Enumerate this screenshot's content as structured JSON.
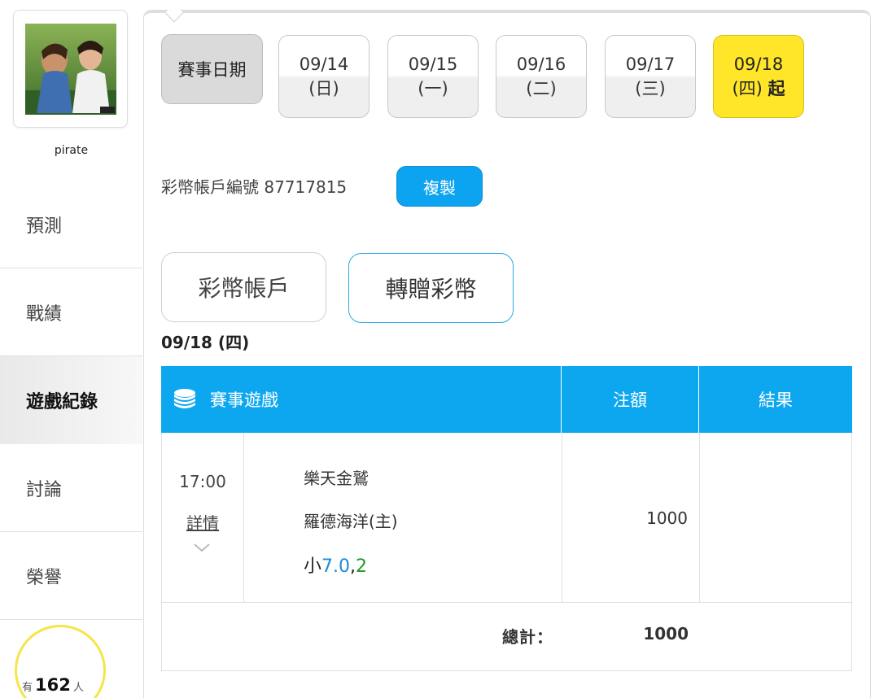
{
  "profile": {
    "username": "pirate"
  },
  "nav": {
    "predict": "預測",
    "record": "戰績",
    "history": "遊戲紀錄",
    "discuss": "討論",
    "honor": "榮譽"
  },
  "online": {
    "prefix": "有",
    "count": "162",
    "suffix": "人"
  },
  "dates": {
    "label": "賽事日期",
    "items": [
      {
        "date": "09/14",
        "weekday": "(日)"
      },
      {
        "date": "09/15",
        "weekday": "(一)"
      },
      {
        "date": "09/16",
        "weekday": "(二)"
      },
      {
        "date": "09/17",
        "weekday": "(三)"
      },
      {
        "date": "09/18",
        "weekday": "(四)",
        "suffix": "起"
      }
    ]
  },
  "account": {
    "label": "彩幣帳戶編號",
    "number": "87717815",
    "copy_label": "複製"
  },
  "tabs": {
    "account": "彩幣帳戶",
    "gift": "轉贈彩幣"
  },
  "selected_date_heading": "09/18 (四)",
  "table": {
    "headers": {
      "game": "賽事遊戲",
      "bet": "注額",
      "result": "結果"
    },
    "rows": [
      {
        "time": "17:00",
        "detail": "詳情",
        "team_away": "樂天金鷲",
        "team_home": "羅德海洋(主)",
        "pick_label": "小",
        "pick_line": "7.0",
        "pick_sep": ",",
        "pick_odds": "2",
        "bet": "1000",
        "result": ""
      }
    ],
    "total_label": "總計：",
    "total_value": "1000"
  },
  "colors": {
    "accent_blue": "#0da7ef",
    "selected_date": "#ffe629",
    "odds_green": "#1f9b2a",
    "line_blue": "#1a8cd8"
  }
}
